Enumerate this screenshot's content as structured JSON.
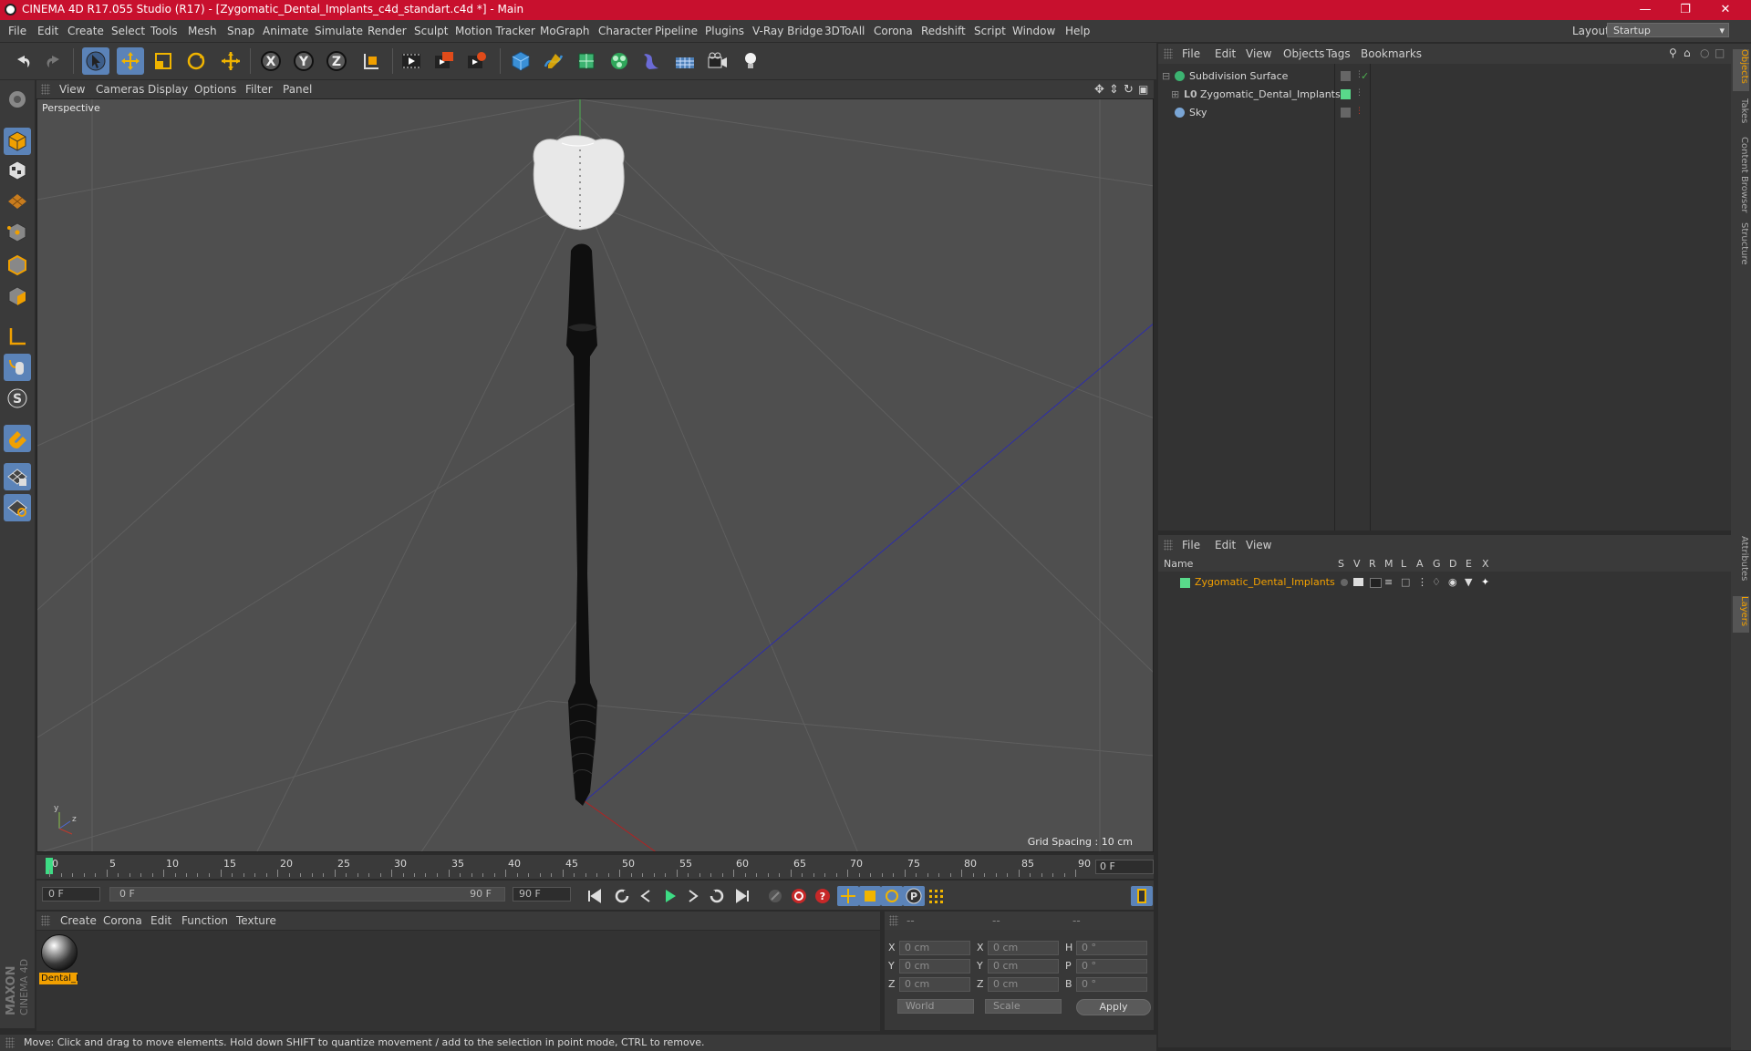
{
  "window": {
    "title": "CINEMA 4D R17.055 Studio (R17) - [Zygomatic_Dental_Implants_c4d_standart.c4d *] - Main"
  },
  "menubar": {
    "items": [
      "File",
      "Edit",
      "Create",
      "Select",
      "Tools",
      "Mesh",
      "Snap",
      "Animate",
      "Simulate",
      "Render",
      "Sculpt",
      "Motion Tracker",
      "MoGraph",
      "Character",
      "Pipeline",
      "Plugins",
      "V-Ray Bridge",
      "3DToAll",
      "Corona",
      "Redshift",
      "Script",
      "Window",
      "Help"
    ],
    "layout_label": "Layout:",
    "layout_value": "Startup"
  },
  "toolbar": {
    "icons": [
      "undo-icon",
      "redo-icon",
      "select-arrow-icon",
      "move-icon",
      "scale-icon",
      "rotate-icon",
      "live-select-icon",
      "x-axis-icon",
      "y-axis-icon",
      "z-axis-icon",
      "world-coordinate-icon",
      "render-view-icon",
      "render-picture-viewer-icon",
      "edit-render-settings-icon",
      "cube-primitive-icon",
      "pen-spline-icon",
      "subdivision-nurbs-icon",
      "cloner-icon",
      "deformer-icon",
      "floor-grid-icon",
      "camera-icon",
      "light-icon"
    ]
  },
  "viewport": {
    "menu": [
      "View",
      "Cameras",
      "Display",
      "Options",
      "Filter",
      "Panel"
    ],
    "label": "Perspective",
    "grid_spacing": "Grid Spacing : 10 cm"
  },
  "timeline": {
    "ticks": [
      "0",
      "5",
      "10",
      "15",
      "20",
      "25",
      "30",
      "35",
      "40",
      "45",
      "50",
      "55",
      "60",
      "65",
      "70",
      "75",
      "80",
      "85",
      "90"
    ],
    "current_frame": "0 F",
    "start_field": "0 F",
    "range_start": "0 F",
    "range_end": "90 F",
    "end_field": "90 F"
  },
  "materials": {
    "menu": [
      "Create",
      "Corona",
      "Edit",
      "Function",
      "Texture"
    ],
    "items": [
      {
        "label": "Dental_I"
      }
    ]
  },
  "coordinates": {
    "headers": [
      "--",
      "--",
      "--"
    ],
    "rows": [
      {
        "a": "X",
        "av": "0 cm",
        "b": "X",
        "bv": "0 cm",
        "c": "H",
        "cv": "0 °"
      },
      {
        "a": "Y",
        "av": "0 cm",
        "b": "Y",
        "bv": "0 cm",
        "c": "P",
        "cv": "0 °"
      },
      {
        "a": "Z",
        "av": "0 cm",
        "b": "Z",
        "bv": "0 cm",
        "c": "B",
        "cv": "0 °"
      }
    ],
    "mode1": "World",
    "mode2": "Scale",
    "apply": "Apply"
  },
  "object_manager": {
    "menu": [
      "File",
      "Edit",
      "View",
      "Objects",
      "Tags",
      "Bookmarks"
    ],
    "objects": [
      {
        "name": "Subdivision Surface",
        "icon": "subdivision-surface-icon"
      },
      {
        "name": "Zygomatic_Dental_Implants",
        "icon": "null-object-icon"
      },
      {
        "name": "Sky",
        "icon": "sky-icon"
      }
    ]
  },
  "layer_manager": {
    "menu": [
      "File",
      "Edit",
      "View"
    ],
    "columns": [
      "Name",
      "S",
      "V",
      "R",
      "M",
      "L",
      "A",
      "G",
      "D",
      "E",
      "X"
    ],
    "layers": [
      {
        "name": "Zygomatic_Dental_Implants",
        "color": "#59d98a"
      }
    ]
  },
  "right_tabs": [
    "Objects",
    "Takes",
    "Content Browser",
    "Structure",
    "Attributes",
    "Layers"
  ],
  "statusbar": {
    "text": "Move: Click and drag to move elements. Hold down SHIFT to quantize movement / add to the selection in point mode, CTRL to remove."
  },
  "brand": "MAXON CINEMA 4D",
  "colors": {
    "title_bar": "#c8102e",
    "selected": "#5b83b8",
    "highlight": "#f2a000"
  }
}
